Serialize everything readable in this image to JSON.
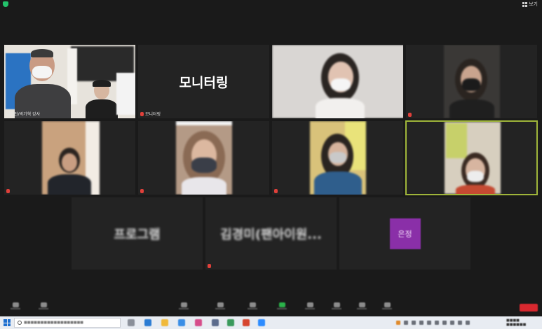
{
  "topbar": {
    "view_label": "보기"
  },
  "tiles": [
    {
      "name": "김현진/박기혁 강사",
      "label": "",
      "muted": false
    },
    {
      "name": "모니터링",
      "label": "모니터링",
      "muted": true
    },
    {
      "name": "",
      "label": "",
      "muted": false
    },
    {
      "name": "",
      "label": "",
      "muted": true
    },
    {
      "name": "",
      "label": "",
      "muted": true
    },
    {
      "name": "",
      "label": "",
      "muted": true
    },
    {
      "name": "",
      "label": "",
      "muted": true
    },
    {
      "name": "",
      "label": "",
      "muted": false
    },
    {
      "name": "",
      "label": "프로그램",
      "muted": false
    },
    {
      "name": "",
      "label": "김경미(팬아이원...",
      "muted": true
    },
    {
      "name": "",
      "label": "",
      "avatar": "은정",
      "muted": false
    }
  ],
  "colors": {
    "active_speaker": "#9fb53a",
    "avatar_purple": "#8a2fa8",
    "end_button": "#d8282f"
  }
}
